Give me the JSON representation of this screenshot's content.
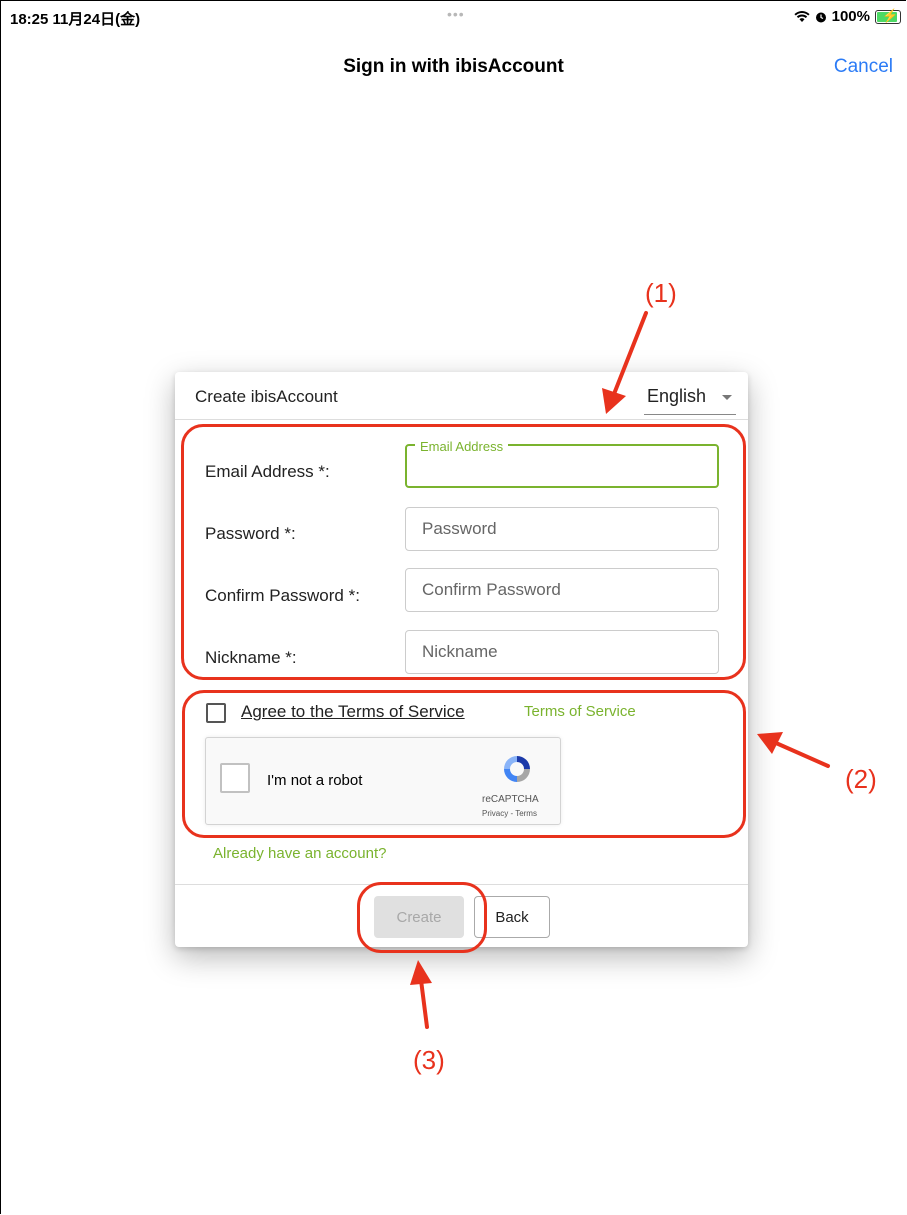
{
  "status_bar": {
    "time": "18:25  11月24日(金)",
    "dots": "•••",
    "battery": "100%"
  },
  "nav": {
    "title": "Sign in with ibisAccount",
    "cancel": "Cancel"
  },
  "dialog": {
    "title": "Create ibisAccount",
    "language": "English",
    "fields": [
      {
        "label": "Email Address *:",
        "placeholder": "",
        "floating_label": "Email Address"
      },
      {
        "label": "Password *:",
        "placeholder": "Password"
      },
      {
        "label": "Confirm Password *:",
        "placeholder": "Confirm Password"
      },
      {
        "label": "Nickname *:",
        "placeholder": "Nickname"
      }
    ],
    "agree_terms": "Agree to the Terms of Service",
    "terms_link": "Terms of Service",
    "recaptcha": {
      "label": "I'm not a robot",
      "brand": "reCAPTCHA",
      "links": "Privacy - Terms"
    },
    "already_account": "Already have an account?",
    "create_button": "Create",
    "back_button": "Back"
  },
  "annotations": {
    "label_1": "(1)",
    "label_2": "(2)",
    "label_3": "(3)"
  },
  "colors": {
    "accent_green": "#7ab32e",
    "annotation_red": "#e8321d",
    "ios_blue": "#2b7bf6"
  }
}
